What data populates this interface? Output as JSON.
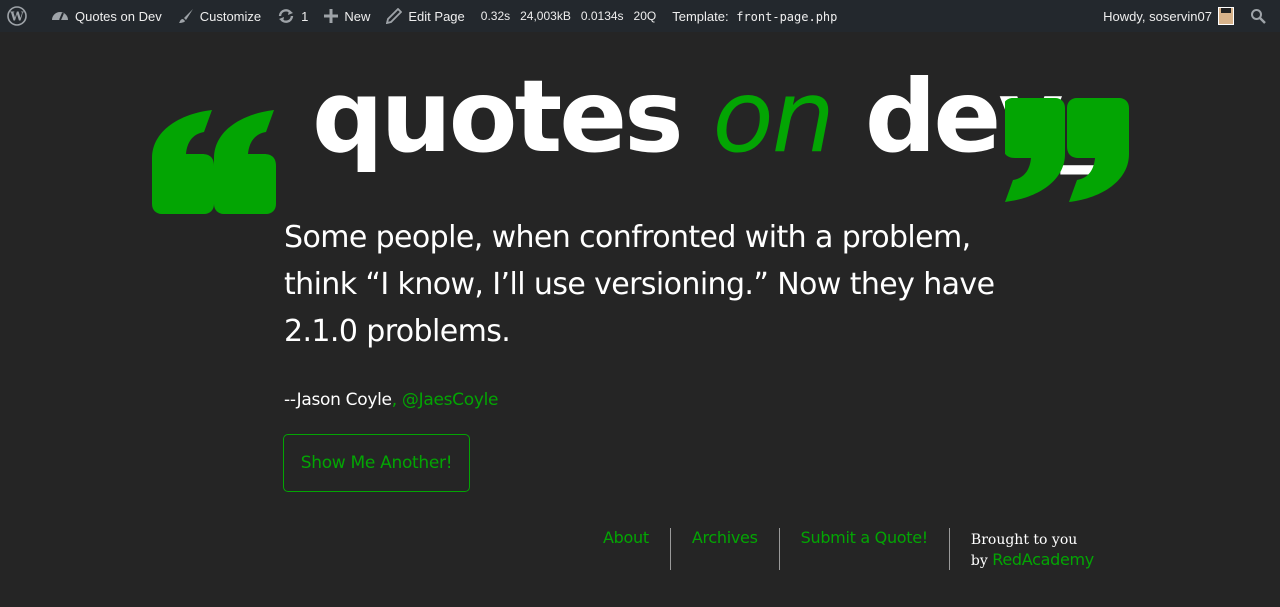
{
  "adminbar": {
    "site_name": "Quotes on Dev",
    "customize": "Customize",
    "updates_count": "1",
    "new": "New",
    "edit_page": "Edit Page",
    "perf": [
      "0.32s",
      "24,003kB",
      "0.0134s",
      "20Q"
    ],
    "template_label": "Template:",
    "template_file": "front-page.php",
    "howdy": "Howdy, soservin07"
  },
  "header": {
    "logo_word1": "quotes",
    "logo_word2": "on",
    "logo_word3": "dev_"
  },
  "quote": {
    "text": "Some people, when confronted with a problem, think “I know, I’ll use versioning.” Now they have 2.1.0 problems.",
    "author": "--Jason Coyle",
    "separator": ", ",
    "handle": "@JaesCoyle"
  },
  "button": {
    "label": "Show Me Another!"
  },
  "footer": {
    "nav": [
      "About",
      "Archives",
      "Submit a Quote!"
    ],
    "credit_line1": "Brought to you",
    "credit_by": "by",
    "credit_brand": "RedAcademy"
  },
  "colors": {
    "accent": "#03a503",
    "background": "#252525",
    "adminbar": "#23282d"
  }
}
